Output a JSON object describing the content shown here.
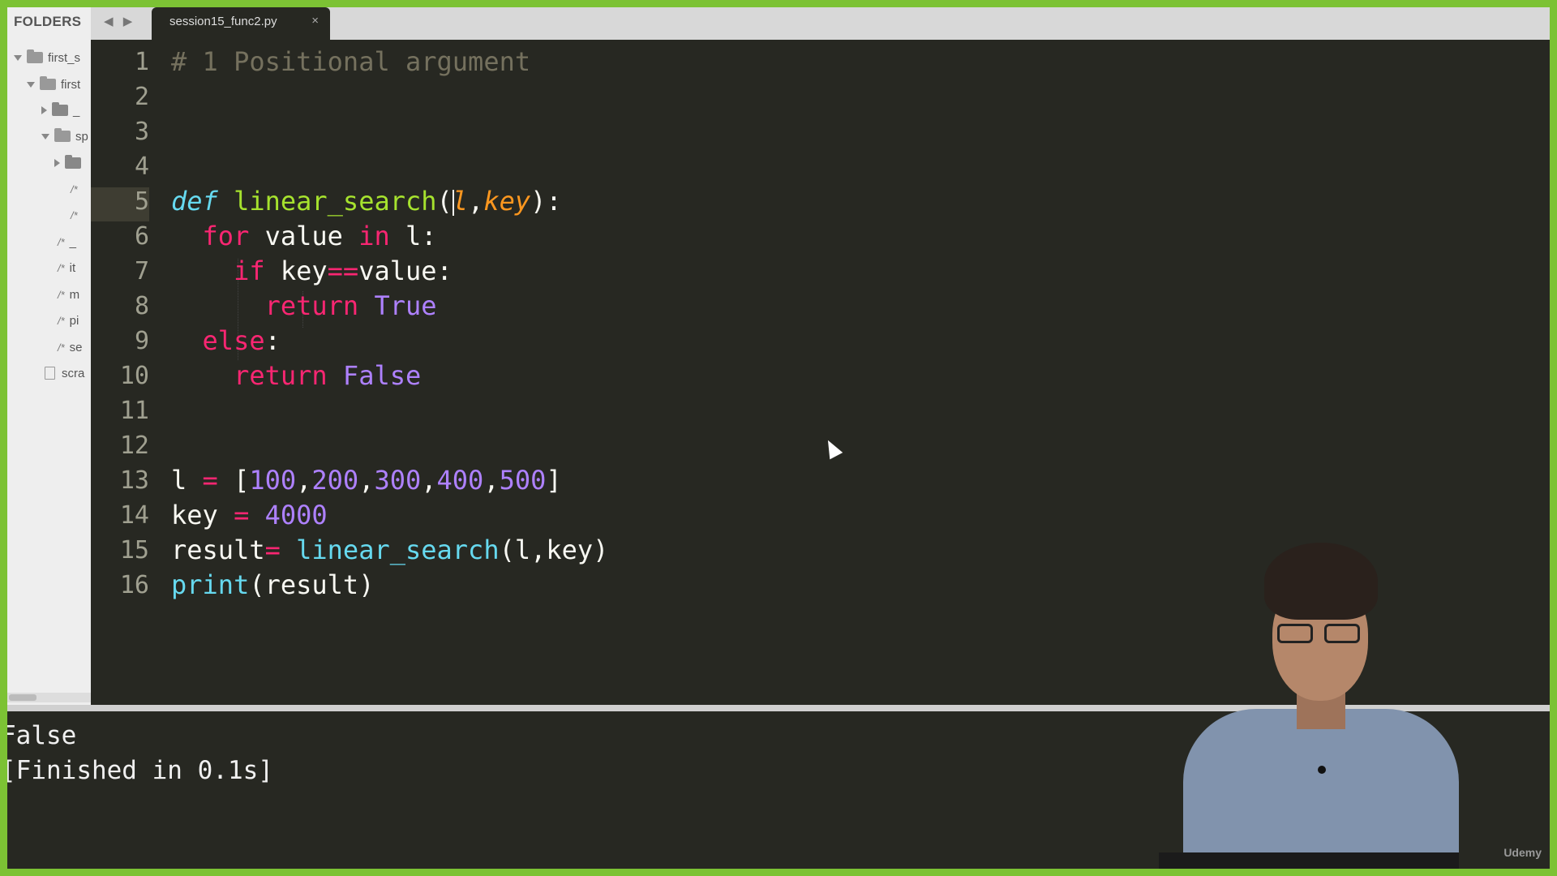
{
  "sidebar": {
    "header": "FOLDERS",
    "items": [
      {
        "label": "first_s",
        "icon": "folder-open-icon"
      },
      {
        "label": "first",
        "icon": "folder-open-icon"
      },
      {
        "label": "_",
        "icon": "folder-icon"
      },
      {
        "label": "sp",
        "icon": "folder-open-icon"
      },
      {
        "label": "",
        "icon": "folder-icon"
      },
      {
        "label": "",
        "icon": "comment-file-icon"
      },
      {
        "label": "",
        "icon": "comment-file-icon"
      },
      {
        "label": "_",
        "icon": "comment-file-icon"
      },
      {
        "label": "it",
        "icon": "comment-file-icon"
      },
      {
        "label": "m",
        "icon": "comment-file-icon"
      },
      {
        "label": "pi",
        "icon": "comment-file-icon"
      },
      {
        "label": "se",
        "icon": "comment-file-icon"
      },
      {
        "label": "scra",
        "icon": "file-icon"
      }
    ]
  },
  "tabbar": {
    "nav": "◀ ▶",
    "tab_label": "session15_func2.py",
    "close_label": "×"
  },
  "editor": {
    "line_numbers": [
      "1",
      "2",
      "3",
      "4",
      "5",
      "6",
      "7",
      "8",
      "9",
      "10",
      "11",
      "12",
      "13",
      "14",
      "15",
      "16"
    ],
    "current_line": "5",
    "code": {
      "l1": "# 1 Positional argument",
      "l5_def": "def",
      "l5_fn": "linear_search",
      "l5_p1": "l",
      "l5_p2": "key",
      "l6_for": "for",
      "l6_var": " value ",
      "l6_in": "in",
      "l6_rest": " l:",
      "l7_if": "if",
      "l7_a": " key",
      "l7_op": "==",
      "l7_b": "value:",
      "l8_ret": "return",
      "l8_val": "True",
      "l9_else": "else",
      "l10_ret": "return",
      "l10_val": "False",
      "l13_var": "l ",
      "l13_op": "=",
      "l13_nums": [
        "100",
        "200",
        "300",
        "400",
        "500"
      ],
      "l14_var": "key ",
      "l14_op": "=",
      "l14_num": "4000",
      "l15_var": "result",
      "l15_op": "=",
      "l15_fn": "linear_search",
      "l15_args": "(l,key)",
      "l16_fn": "print",
      "l16_args": "(result)"
    }
  },
  "output": {
    "line1": "False",
    "line2": "[Finished in 0.1s]"
  },
  "watermark": "Udemy",
  "colors": {
    "background": "#272822",
    "comment": "#75715e",
    "keyword": "#f92672",
    "function": "#a6e22e",
    "parameter": "#fd971f",
    "number": "#ae81ff",
    "builtin": "#66d9ef",
    "border": "#7cc234"
  }
}
